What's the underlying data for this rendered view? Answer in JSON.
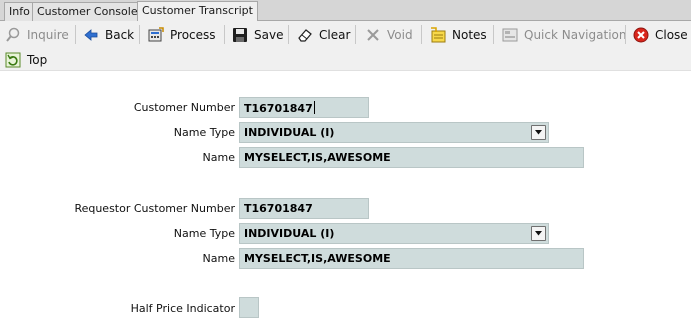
{
  "tabs": [
    "Info",
    "Customer Console",
    "Customer Transcript"
  ],
  "toolbar": {
    "inquire": "Inquire",
    "back": "Back",
    "process": "Process",
    "save": "Save",
    "clear": "Clear",
    "void": "Void",
    "notes": "Notes",
    "quick_navigation": "Quick Navigation",
    "close": "Close",
    "top": "Top"
  },
  "form": {
    "customer_number_label": "Customer Number",
    "customer_number": "T16701847",
    "name_type_label": "Name Type",
    "name_type": "INDIVIDUAL (I)",
    "name_label": "Name",
    "name": "MYSELECT,IS,AWESOME",
    "requestor_customer_number_label": "Requestor Customer Number",
    "requestor_customer_number": "T16701847",
    "requestor_name_type_label": "Name Type",
    "requestor_name_type": "INDIVIDUAL (I)",
    "requestor_name_label": "Name",
    "requestor_name": "MYSELECT,IS,AWESOME",
    "half_price_indicator_label": "Half Price Indicator"
  }
}
